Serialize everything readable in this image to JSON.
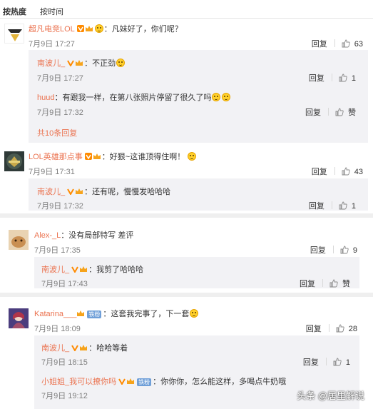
{
  "sort_tabs": [
    "按热度",
    "按时间"
  ],
  "actions": {
    "reply": "回复",
    "like_word": "赞"
  },
  "watermark": "头条 @居里解说",
  "comments": [
    {
      "user": "超凡电竞LOL",
      "sep": "：",
      "text": "凡妹好了，你们呢？",
      "time": "7月9日 17:27",
      "likes": "63",
      "replies": [
        {
          "user": "南波儿_",
          "sep": "：",
          "text": "不正劲",
          "time": "7月9日 17:27",
          "likes": "1"
        },
        {
          "user": "huud",
          "sep": "：",
          "text": "有跟我一样，在第八张照片停留了很久了吗",
          "time": "7月9日 17:32",
          "likes": "赞"
        }
      ],
      "more": "共10条回复"
    },
    {
      "user": "LOL英雄那点事",
      "sep": "：",
      "text": "好狠~这谁顶得住啊！",
      "time": "7月9日 17:31",
      "likes": "43",
      "replies": [
        {
          "user": "南波儿_",
          "sep": "：",
          "text": "还有呢，慢慢发哈哈哈",
          "time": "7月9日 17:32",
          "likes": "1"
        }
      ]
    },
    {
      "user": "Alex-_L",
      "sep": "：",
      "text": "没有局部特写 差评",
      "time": "7月9日 17:35",
      "likes": "9",
      "replies": [
        {
          "user": "南波儿_",
          "sep": "：",
          "text": "我剪了哈哈哈",
          "time": "7月9日 17:43",
          "likes": "赞"
        }
      ]
    },
    {
      "user": "Katarina___",
      "badge": "铁粉",
      "sep": "：",
      "text": "这套我完事了，下一套",
      "time": "7月9日 18:09",
      "likes": "28",
      "replies": [
        {
          "user": "南波儿_",
          "sep": "：",
          "text": "哈哈等着",
          "time": "7月9日 18:15",
          "likes": "1"
        },
        {
          "user": "小姐姐_我可以撩你吗",
          "badge": "铁粉",
          "sep": "：",
          "text": "你你你，怎么能这样，多喝点牛奶哦",
          "time": "7月9日 19:12",
          "likes": ""
        }
      ]
    }
  ]
}
